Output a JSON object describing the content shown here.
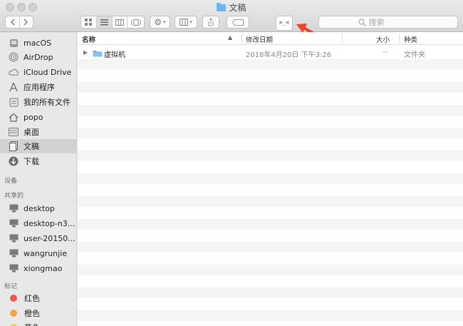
{
  "window": {
    "title": "文稿"
  },
  "toolbar": {
    "terminal_label": ">_<",
    "search_placeholder": "搜索"
  },
  "sidebar": {
    "favorites": [
      {
        "label": "macOS",
        "icon": "disk-icon"
      },
      {
        "label": "AirDrop",
        "icon": "airdrop-icon"
      },
      {
        "label": "iCloud Drive",
        "icon": "cloud-icon"
      },
      {
        "label": "应用程序",
        "icon": "apps-icon"
      },
      {
        "label": "我的所有文件",
        "icon": "all-files-icon"
      },
      {
        "label": "popo",
        "icon": "home-icon"
      },
      {
        "label": "桌面",
        "icon": "desktop-icon"
      },
      {
        "label": "文稿",
        "icon": "documents-icon",
        "selected": true
      },
      {
        "label": "下载",
        "icon": "download-icon"
      }
    ],
    "devices_header": "设备",
    "shared_header": "共享的",
    "shared": [
      {
        "label": "desktop"
      },
      {
        "label": "desktop-n3..."
      },
      {
        "label": "user-20150..."
      },
      {
        "label": "wangrunjie"
      },
      {
        "label": "xiongmao"
      }
    ],
    "tags_header": "标记",
    "tags": [
      {
        "label": "红色",
        "color": "#e9594f"
      },
      {
        "label": "橙色",
        "color": "#f2a64a"
      },
      {
        "label": "黄色",
        "color": "#f2cf3a"
      }
    ]
  },
  "list": {
    "columns": {
      "name": "名称",
      "modified": "修改日期",
      "size": "大小",
      "kind": "种类"
    },
    "rows": [
      {
        "name": "虚拟机",
        "modified": "2018年4月20日 下午3:26",
        "size": "--",
        "kind": "文件夹"
      }
    ]
  },
  "colors": {
    "accent_arrow": "#e8452a",
    "folder": "#6db6ec"
  }
}
